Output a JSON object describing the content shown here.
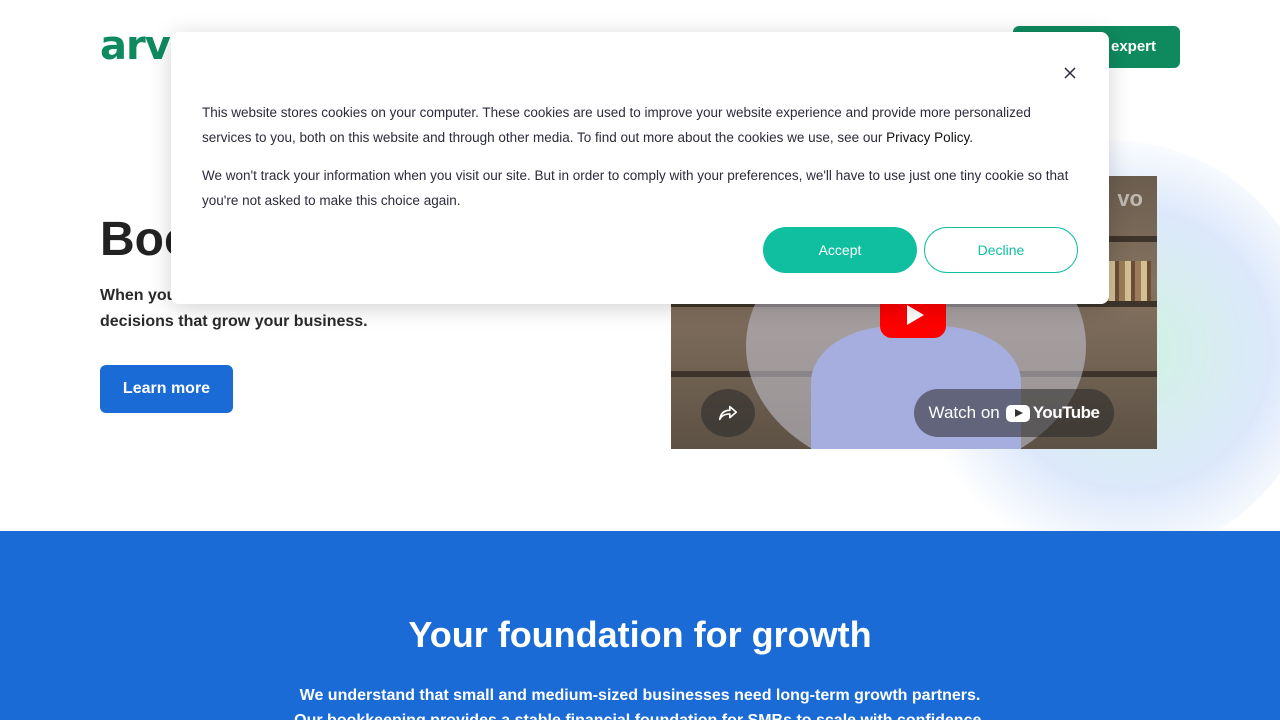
{
  "header": {
    "logo_text": "arvo",
    "cta_label": "Talk to an expert"
  },
  "hero": {
    "title": "Bookkeeping",
    "text_line1": "When you",
    "text_line2": "decisions that grow your business.",
    "learn_more_label": "Learn more"
  },
  "video": {
    "watch_on_label": "Watch on",
    "youtube_label": "YouTube",
    "watermark": "vo"
  },
  "foundation": {
    "title": "Your foundation for growth",
    "text_line1": "We understand that small and medium-sized businesses need long-term growth partners.",
    "text_line2": "Our bookkeeping provides a stable financial foundation for SMBs to scale with confidence."
  },
  "cookie_banner": {
    "paragraph1": "This website stores cookies on your computer. These cookies are used to improve your website experience and provide more personalized services to you, both on this website and through other media. To find out more about the cookies we use, see our",
    "privacy_link": "Privacy Policy.",
    "paragraph2": "We won't track your information when you visit our site. But in order to comply with your preferences, we'll have to use just one tiny cookie so that you're not asked to make this choice again.",
    "accept_label": "Accept",
    "decline_label": "Decline",
    "close_symbol": "✕"
  },
  "colors": {
    "brand_green": "#0f8a5f",
    "primary_blue": "#1b6bd6",
    "accept_teal": "#0fbfa0"
  }
}
